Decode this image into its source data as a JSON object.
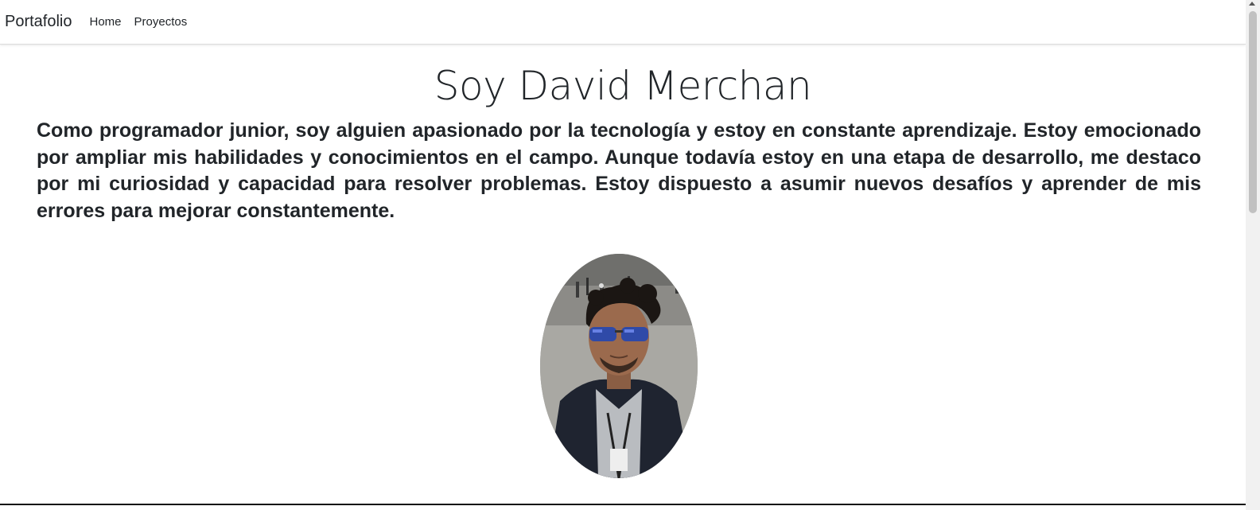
{
  "navbar": {
    "brand": "Portafolio",
    "links": [
      {
        "label": "Home"
      },
      {
        "label": "Proyectos"
      }
    ]
  },
  "main": {
    "title": "Soy David Merchan",
    "intro": "Como programador junior, soy alguien apasionado por la tecnología y estoy en constante aprendizaje. Estoy emocionado por ampliar mis habilidades y conocimientos en el campo. Aunque todavía estoy en una etapa de desarrollo, me destaco por mi curiosidad y capacidad para resolver problemas. Estoy dispuesto a asumir nuevos desafíos y aprender de mis errores para mejorar constantemente.",
    "photo": {
      "shape": "oval",
      "subject": "profile-photo"
    }
  },
  "colors": {
    "text": "#212529",
    "background": "#ffffff",
    "navbar_border": "#dcdcdc",
    "scrollbar_thumb": "#c1c1c1"
  }
}
